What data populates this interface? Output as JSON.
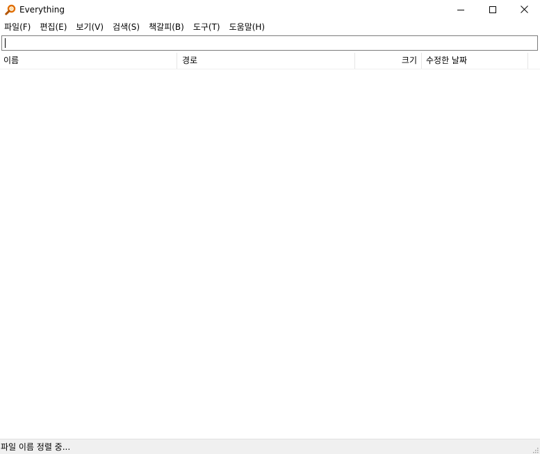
{
  "window": {
    "title": "Everything",
    "app_icon": "magnifier-icon",
    "controls": [
      "minimize-icon",
      "maximize-icon",
      "close-icon"
    ]
  },
  "menu": [
    {
      "label": "파일(F)"
    },
    {
      "label": "편집(E)"
    },
    {
      "label": "보기(V)"
    },
    {
      "label": "검색(S)"
    },
    {
      "label": "책갈피(B)"
    },
    {
      "label": "도구(T)"
    },
    {
      "label": "도움말(H)"
    }
  ],
  "search": {
    "value": "",
    "placeholder": ""
  },
  "columns": {
    "name": "이름",
    "path": "경로",
    "size": "크기",
    "date_modified": "수정한 날짜"
  },
  "results": [],
  "status": {
    "text": "파일 이름 정렬 중..."
  },
  "colors": {
    "icon_accent": "#e06d00",
    "statusbar_bg": "#f0f0f0"
  }
}
